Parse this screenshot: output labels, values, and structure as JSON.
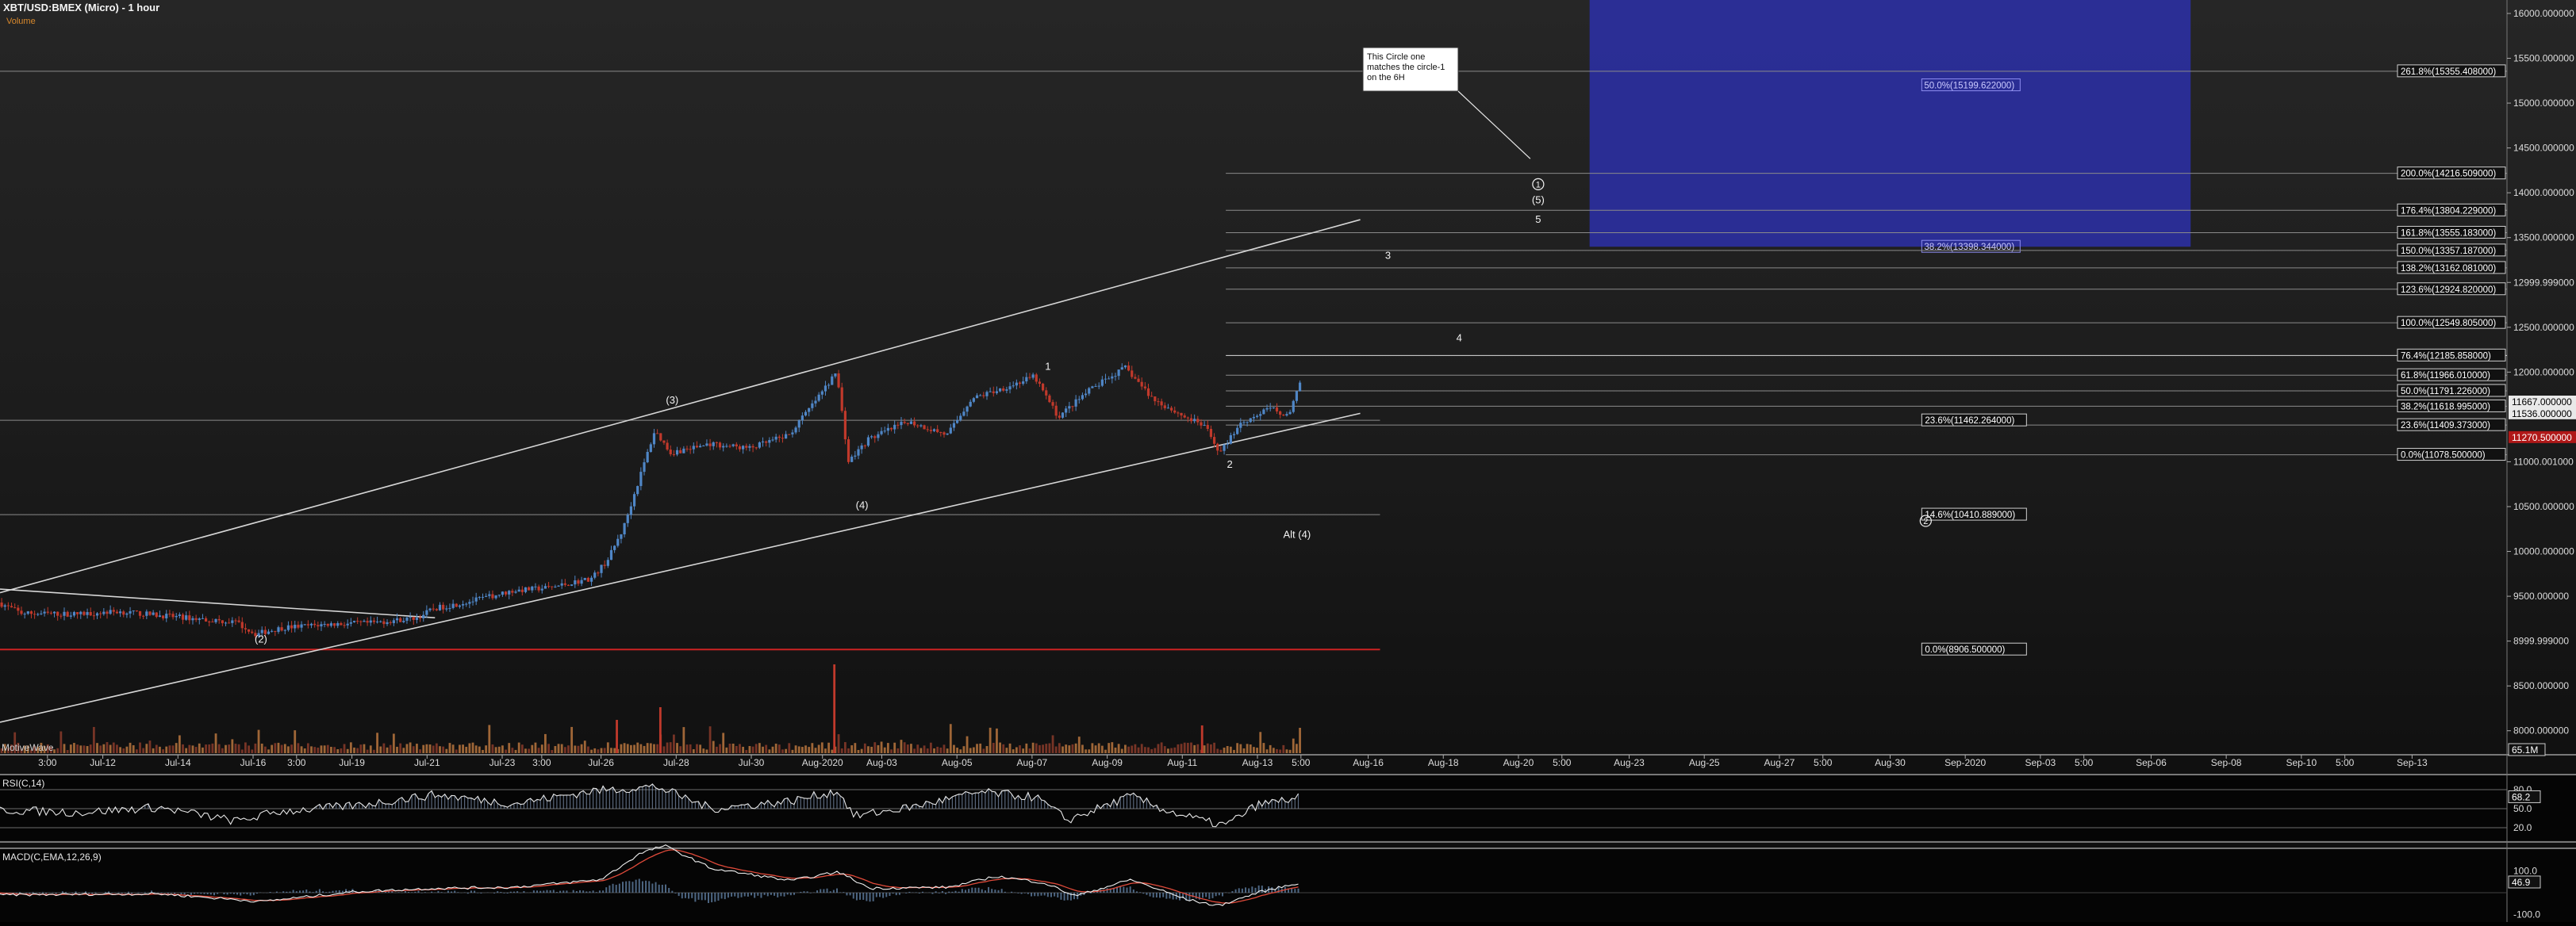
{
  "header": {
    "symbol_title": "XBT/USD:BMEX (Micro) - 1 hour",
    "volume_label": "Volume"
  },
  "chart_data": [
    {
      "type": "candlestick",
      "title": "XBT/USD:BMEX (Micro) - 1 hour",
      "y_axis": {
        "ylim": [
          7750,
          16150
        ],
        "tick_labels": [
          {
            "value": 16000,
            "label": "16000.000000"
          },
          {
            "value": 15500,
            "label": "15500.000000"
          },
          {
            "value": 15000,
            "label": "15000.000000"
          },
          {
            "value": 14500,
            "label": "14500.000000"
          },
          {
            "value": 14000,
            "label": "14000.000000"
          },
          {
            "value": 13500,
            "label": "13500.000000"
          },
          {
            "value": 13000,
            "label": "12999.999000"
          },
          {
            "value": 12500,
            "label": "12500.000000"
          },
          {
            "value": 12000,
            "label": "12000.000000"
          },
          {
            "value": 11000,
            "label": "11000.001000"
          },
          {
            "value": 10500,
            "label": "10500.000000"
          },
          {
            "value": 10000,
            "label": "10000.000000"
          },
          {
            "value": 9500,
            "label": "9500.000000"
          },
          {
            "value": 9000,
            "label": "8999.999000"
          },
          {
            "value": 8500,
            "label": "8500.000000"
          },
          {
            "value": 8000,
            "label": "8000.000000"
          }
        ],
        "price_tags": [
          {
            "value": 11667,
            "label": "11667.000000",
            "style": "white"
          },
          {
            "value": 11536,
            "label": "11536.000000",
            "style": "white"
          },
          {
            "value": 11270.5,
            "label": "11270.500000",
            "style": "red"
          }
        ]
      },
      "x_axis": {
        "xlim": [
          0,
          31.7
        ],
        "unit": "days from the left edge of the chart",
        "tick_labels": [
          {
            "t": 0.6,
            "label": "3:00"
          },
          {
            "t": 1.3,
            "label": "Jul-12"
          },
          {
            "t": 2.25,
            "label": "Jul-14"
          },
          {
            "t": 3.2,
            "label": "Jul-16"
          },
          {
            "t": 3.75,
            "label": "3:00"
          },
          {
            "t": 4.45,
            "label": "Jul-19"
          },
          {
            "t": 5.4,
            "label": "Jul-21"
          },
          {
            "t": 6.35,
            "label": "Jul-23"
          },
          {
            "t": 6.85,
            "label": "3:00"
          },
          {
            "t": 7.6,
            "label": "Jul-26"
          },
          {
            "t": 8.55,
            "label": "Jul-28"
          },
          {
            "t": 9.5,
            "label": "Jul-30"
          },
          {
            "t": 10.4,
            "label": "Aug-2020"
          },
          {
            "t": 11.15,
            "label": "Aug-03"
          },
          {
            "t": 12.1,
            "label": "Aug-05"
          },
          {
            "t": 13.05,
            "label": "Aug-07"
          },
          {
            "t": 14.0,
            "label": "Aug-09"
          },
          {
            "t": 14.95,
            "label": "Aug-11"
          },
          {
            "t": 15.9,
            "label": "Aug-13"
          },
          {
            "t": 16.45,
            "label": "5:00"
          },
          {
            "t": 17.3,
            "label": "Aug-16"
          },
          {
            "t": 18.25,
            "label": "Aug-18"
          },
          {
            "t": 19.2,
            "label": "Aug-20"
          },
          {
            "t": 19.75,
            "label": "5:00"
          },
          {
            "t": 20.6,
            "label": "Aug-23"
          },
          {
            "t": 21.55,
            "label": "Aug-25"
          },
          {
            "t": 22.5,
            "label": "Aug-27"
          },
          {
            "t": 23.05,
            "label": "5:00"
          },
          {
            "t": 23.9,
            "label": "Aug-30"
          },
          {
            "t": 24.85,
            "label": "Sep-2020"
          },
          {
            "t": 25.8,
            "label": "Sep-03"
          },
          {
            "t": 26.35,
            "label": "5:00"
          },
          {
            "t": 27.2,
            "label": "Sep-06"
          },
          {
            "t": 28.15,
            "label": "Sep-08"
          },
          {
            "t": 29.1,
            "label": "Sep-10"
          },
          {
            "t": 29.65,
            "label": "5:00"
          },
          {
            "t": 30.5,
            "label": "Sep-13"
          }
        ]
      },
      "price_path_waypoints": [
        [
          0.0,
          9430
        ],
        [
          0.3,
          9310
        ],
        [
          1.0,
          9300
        ],
        [
          1.5,
          9330
        ],
        [
          2.0,
          9290
        ],
        [
          2.5,
          9250
        ],
        [
          3.0,
          9210
        ],
        [
          3.25,
          9080
        ],
        [
          3.6,
          9150
        ],
        [
          4.2,
          9190
        ],
        [
          4.7,
          9200
        ],
        [
          5.3,
          9260
        ],
        [
          5.5,
          9360
        ],
        [
          6.0,
          9450
        ],
        [
          6.5,
          9560
        ],
        [
          7.0,
          9600
        ],
        [
          7.5,
          9700
        ],
        [
          7.7,
          9900
        ],
        [
          7.9,
          10250
        ],
        [
          8.1,
          10800
        ],
        [
          8.3,
          11350
        ],
        [
          8.5,
          11100
        ],
        [
          9.0,
          11200
        ],
        [
          9.5,
          11150
        ],
        [
          10.0,
          11300
        ],
        [
          10.35,
          11700
        ],
        [
          10.6,
          12000
        ],
        [
          10.75,
          11000
        ],
        [
          11.0,
          11250
        ],
        [
          11.5,
          11450
        ],
        [
          12.0,
          11300
        ],
        [
          12.3,
          11700
        ],
        [
          12.8,
          11850
        ],
        [
          13.1,
          11950
        ],
        [
          13.4,
          11500
        ],
        [
          13.8,
          11800
        ],
        [
          14.25,
          12050
        ],
        [
          14.6,
          11700
        ],
        [
          15.0,
          11500
        ],
        [
          15.25,
          11400
        ],
        [
          15.45,
          11100
        ],
        [
          15.7,
          11430
        ],
        [
          16.1,
          11600
        ],
        [
          16.3,
          11500
        ],
        [
          16.45,
          11860
        ]
      ],
      "levels": [
        {
          "y": 15355.408,
          "label": "261.8%(15355.408000)",
          "start_t": 0,
          "label_side": "right"
        },
        {
          "y": 15199.622,
          "label": "50.0%(15199.622000)",
          "start_t": 0,
          "label_side": "box",
          "style": "blue"
        },
        {
          "y": 14216.509,
          "label": "200.0%(14216.509000)",
          "start_t": 15.5,
          "label_side": "right"
        },
        {
          "y": 13804.229,
          "label": "176.4%(13804.229000)",
          "start_t": 15.5,
          "label_side": "right"
        },
        {
          "y": 13555.183,
          "label": "161.8%(13555.183000)",
          "start_t": 15.5,
          "label_side": "right"
        },
        {
          "y": 13398.344,
          "label": "38.2%(13398.344000)",
          "start_t": 0,
          "label_side": "box",
          "style": "blue"
        },
        {
          "y": 13357.187,
          "label": "150.0%(13357.187000)",
          "start_t": 15.5,
          "label_side": "right"
        },
        {
          "y": 13162.081,
          "label": "138.2%(13162.081000)",
          "start_t": 15.5,
          "label_side": "right"
        },
        {
          "y": 12924.82,
          "label": "123.6%(12924.820000)",
          "start_t": 15.5,
          "label_side": "right"
        },
        {
          "y": 12549.805,
          "label": "100.0%(12549.805000)",
          "start_t": 15.5,
          "label_side": "right"
        },
        {
          "y": 12185.858,
          "label": "76.4%(12185.858000)",
          "start_t": 15.5,
          "label_side": "right",
          "bright": true
        },
        {
          "y": 11966.01,
          "label": "61.8%(11966.010000)",
          "start_t": 15.5,
          "label_side": "right"
        },
        {
          "y": 11791.226,
          "label": "50.0%(11791.226000)",
          "start_t": 15.5,
          "label_side": "right"
        },
        {
          "y": 11618.995,
          "label": "38.2%(11618.995000)",
          "start_t": 15.5,
          "label_side": "right"
        },
        {
          "y": 11409.373,
          "label": "23.6%(11409.373000)",
          "start_t": 15.5,
          "label_side": "right"
        },
        {
          "y": 11078.5,
          "label": "0.0%(11078.500000)",
          "start_t": 15.5,
          "label_side": "right"
        },
        {
          "y": 11462.264,
          "label": "23.6%(11462.264000)",
          "start_t": 0,
          "label_side": "mid"
        },
        {
          "y": 10410.889,
          "label": "14.6%(10410.889000)",
          "start_t": 0,
          "label_side": "mid"
        },
        {
          "y": 8906.5,
          "label": "0.0%(8906.500000)",
          "start_t": 0,
          "label_side": "mid",
          "style": "red"
        }
      ],
      "trendlines": [
        {
          "t1": 0,
          "y1": 8095,
          "t2": 17.2,
          "y2": 11540
        },
        {
          "t1": 0,
          "y1": 9540,
          "t2": 17.2,
          "y2": 13700
        },
        {
          "t1": 0,
          "y1": 9580,
          "t2": 5.5,
          "y2": 9260
        }
      ],
      "target_box": {
        "t1": 20.1,
        "t2": 27.7,
        "y1": 13398.344,
        "y2": 16150
      },
      "wave_labels": [
        {
          "t": 8.5,
          "y": 11650,
          "text": "(3)"
        },
        {
          "t": 3.3,
          "y": 8985,
          "text": "(2)"
        },
        {
          "t": 10.9,
          "y": 10480,
          "text": "(4)"
        },
        {
          "t": 13.25,
          "y": 12025,
          "text": "1"
        },
        {
          "t": 15.55,
          "y": 10935,
          "text": "2"
        },
        {
          "t": 17.55,
          "y": 13265,
          "text": "3"
        },
        {
          "t": 18.45,
          "y": 12345,
          "text": "4"
        },
        {
          "t": 19.45,
          "y": 13665,
          "text": "5"
        },
        {
          "t": 19.45,
          "y": 13880,
          "text": "(5)"
        },
        {
          "t": 16.4,
          "y": 10150,
          "text": "Alt (4)"
        }
      ],
      "circled_labels": [
        {
          "t": 19.45,
          "y": 14060,
          "text": "1"
        },
        {
          "t": 24.35,
          "y": 10305,
          "text": "2"
        }
      ],
      "annotation": {
        "lines": [
          "This Circle one",
          "matches the circle-1",
          "on the 6H"
        ],
        "arrow_to": {
          "t": 19.35,
          "y": 14380
        }
      },
      "panel_badge": "MotiveWave"
    },
    {
      "type": "bar",
      "series": [
        {
          "name": "Volume"
        }
      ],
      "values_note": "hourly volume bars",
      "value_tag": "65.1M"
    },
    {
      "type": "line",
      "title": "RSI(C,14)",
      "ylim": [
        0,
        100
      ],
      "reference_levels": [
        {
          "value": 80,
          "label": "80.0"
        },
        {
          "value": 50,
          "label": "50.0"
        },
        {
          "value": 20,
          "label": "20.0"
        }
      ],
      "last_value_label": "68.2",
      "path_waypoints": [
        [
          0,
          48
        ],
        [
          1,
          44
        ],
        [
          2,
          52
        ],
        [
          3,
          30
        ],
        [
          3.5,
          45
        ],
        [
          4.5,
          55
        ],
        [
          5.5,
          72
        ],
        [
          6.5,
          58
        ],
        [
          7.5,
          78
        ],
        [
          8.3,
          85
        ],
        [
          9,
          50
        ],
        [
          10,
          62
        ],
        [
          10.6,
          78
        ],
        [
          10.8,
          38
        ],
        [
          11.5,
          52
        ],
        [
          12.4,
          76
        ],
        [
          13.1,
          68
        ],
        [
          13.5,
          32
        ],
        [
          14.3,
          70
        ],
        [
          14.8,
          45
        ],
        [
          15.3,
          28
        ],
        [
          15.5,
          24
        ],
        [
          15.9,
          56
        ],
        [
          16.45,
          68
        ]
      ]
    },
    {
      "type": "line",
      "title": "MACD(C,EMA,12,26,9)",
      "reference_levels": [
        {
          "value": 100,
          "label": "100.0"
        },
        {
          "value": -100,
          "label": "-100.0"
        }
      ],
      "last_value_label": "46.9",
      "series": [
        {
          "name": "MACD"
        },
        {
          "name": "Signal"
        }
      ],
      "path_waypoints": [
        [
          0,
          -10
        ],
        [
          2,
          -5
        ],
        [
          3.3,
          -40
        ],
        [
          4.5,
          5
        ],
        [
          5.5,
          20
        ],
        [
          6.5,
          25
        ],
        [
          7.6,
          60
        ],
        [
          8.1,
          180
        ],
        [
          8.4,
          215
        ],
        [
          9.0,
          110
        ],
        [
          10.0,
          55
        ],
        [
          10.6,
          95
        ],
        [
          11.0,
          20
        ],
        [
          12.0,
          25
        ],
        [
          12.6,
          75
        ],
        [
          13.2,
          45
        ],
        [
          13.6,
          -15
        ],
        [
          14.3,
          60
        ],
        [
          15.0,
          -30
        ],
        [
          15.4,
          -60
        ],
        [
          15.9,
          0
        ],
        [
          16.45,
          47
        ]
      ]
    }
  ],
  "colors": {
    "up_candle": "#4f86c6",
    "down_candle": "#c0392b",
    "target_box": "#2b2f9e",
    "level_line": "#8a8a8a",
    "red_level": "#cc2222"
  }
}
